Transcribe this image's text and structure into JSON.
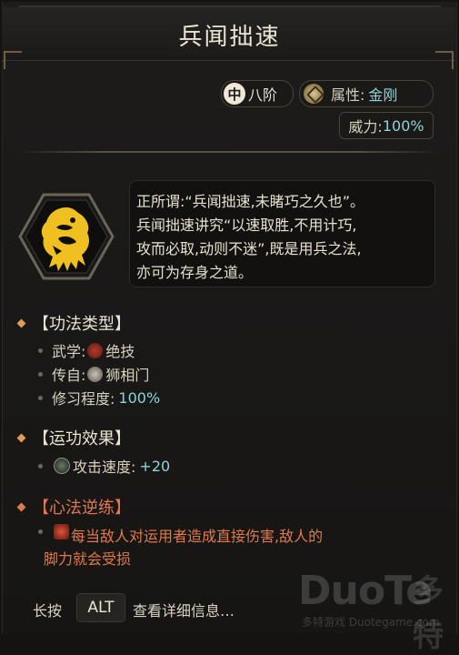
{
  "title": "兵闻拙速",
  "tags": {
    "rank_badge": "中",
    "rank": "八阶",
    "attribute_label": "属性:",
    "attribute_value": "金刚",
    "power_label": "威力:",
    "power_value": "100%"
  },
  "description_lines": [
    "正所谓:“兵闻拙速,未睹巧之久也”。",
    "兵闻拙速讲究“以速取胜,不用计巧,",
    "攻而必取,动则不迷”,既是用兵之法,",
    "亦可为存身之道。"
  ],
  "sections": {
    "type": {
      "heading": "【功法类型】",
      "wuxue_label": "武学:",
      "wuxue_value": "绝技",
      "origin_label": "传自:",
      "origin_value": "狮相门",
      "practice_label": "修习程度:",
      "practice_value": "100%"
    },
    "effect": {
      "heading": "【运功效果】",
      "stat_label": "攻击速度:",
      "stat_value": "+20"
    },
    "reverse": {
      "heading": "【心法逆练】",
      "line1": "每当敌人对运用者造成直接伤害,敌人的",
      "line2": "脚力就会受损"
    }
  },
  "footer": {
    "prefix": "长按",
    "key": "ALT",
    "suffix": "查看详细信息…"
  },
  "watermark": {
    "brand": "DuoTe",
    "brand_cn": "多特",
    "sub": "多特游戏 Duotegame.com"
  },
  "colors": {
    "accent_cyan": "#8fd4d6",
    "accent_orange": "#e19a58",
    "reverse_red": "#e07a4a",
    "icon_gold": "#f0c020"
  },
  "icons": [
    "lion-skill-icon",
    "attribute-jingang-icon",
    "jueji-icon",
    "shixiangmen-icon",
    "attack-speed-icon",
    "reverse-practice-icon"
  ]
}
